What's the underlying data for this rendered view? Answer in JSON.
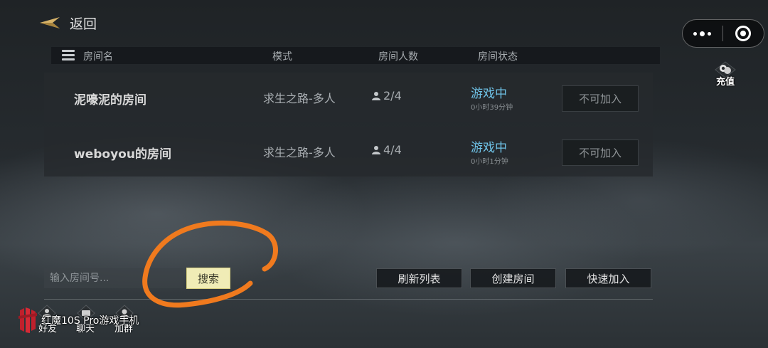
{
  "header": {
    "back_label": "返回"
  },
  "recharge": {
    "label": "充值"
  },
  "table": {
    "columns": {
      "name": "房间名",
      "mode": "模式",
      "players": "房间人数",
      "status": "房间状态"
    },
    "rows": [
      {
        "name": "泥嚎泥的房间",
        "mode": "求生之路-多人",
        "players": "2/4",
        "status": "游戏中",
        "time": "0小时39分钟",
        "join_label": "不可加入"
      },
      {
        "name": "weboyou的房间",
        "mode": "求生之路-多人",
        "players": "4/4",
        "status": "游戏中",
        "time": "0小时1分钟",
        "join_label": "不可加入"
      }
    ]
  },
  "controls": {
    "room_input_placeholder": "输入房间号...",
    "search_label": "搜索",
    "refresh_label": "刷新列表",
    "create_label": "创建房间",
    "quick_join_label": "快速加入"
  },
  "bottom_nav": {
    "friends": "好友",
    "chat": "聊天",
    "group": "加群"
  },
  "watermark": {
    "text": "红魔10S Pro游戏手机"
  },
  "colors": {
    "status": "#6fc3e8",
    "search_bg": "#f0ecb6",
    "annotation": "#f07a1e"
  }
}
